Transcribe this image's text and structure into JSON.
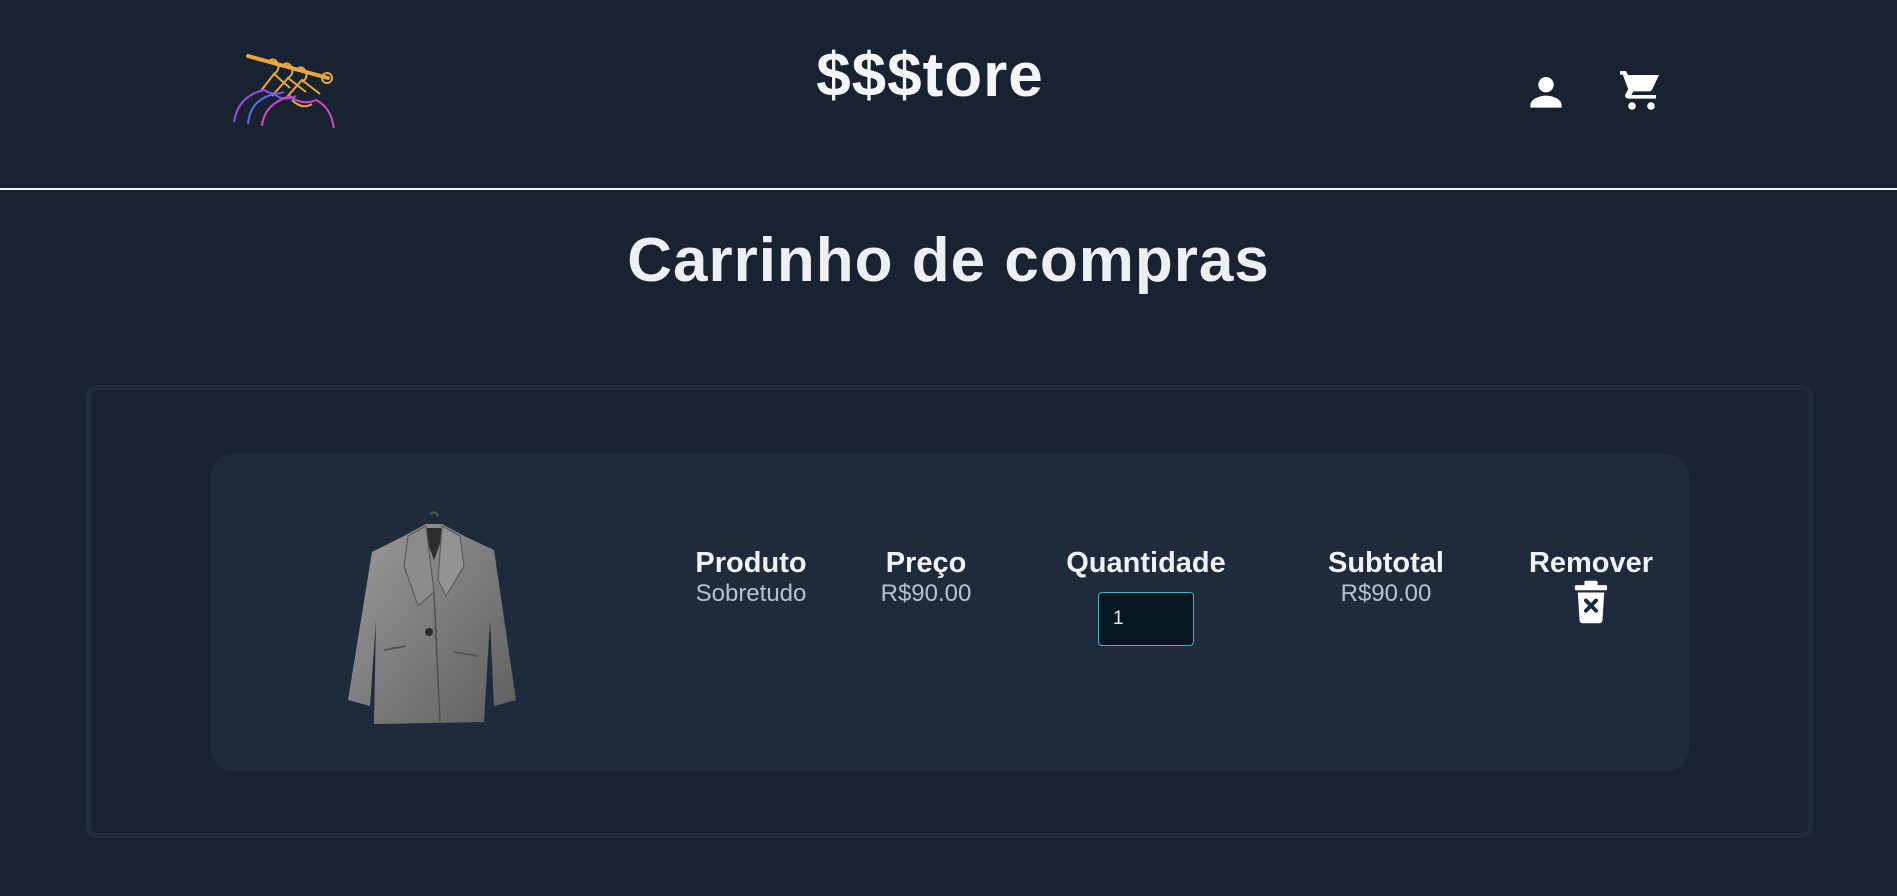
{
  "header": {
    "brand": "$$$tore",
    "logo_icon": "clothes-hanger-rack-icon",
    "user_icon": "user-icon",
    "cart_icon": "shopping-cart-icon"
  },
  "page": {
    "title": "Carrinho de compras"
  },
  "cart": {
    "items": [
      {
        "image_icon": "gray-overcoat-image",
        "columns": {
          "produto_label": "Produto",
          "produto_value": "Sobretudo",
          "preco_label": "Preço",
          "preco_value": "R$90.00",
          "quantidade_label": "Quantidade",
          "quantidade_value": "1",
          "subtotal_label": "Subtotal",
          "subtotal_value": "R$90.00",
          "remover_label": "Remover",
          "remove_icon": "trash-x-icon"
        }
      }
    ]
  },
  "colors": {
    "background": "#182230",
    "card": "#1e2b3d",
    "frame_border": "#1f2c3e",
    "input_border": "#34b6cf"
  }
}
